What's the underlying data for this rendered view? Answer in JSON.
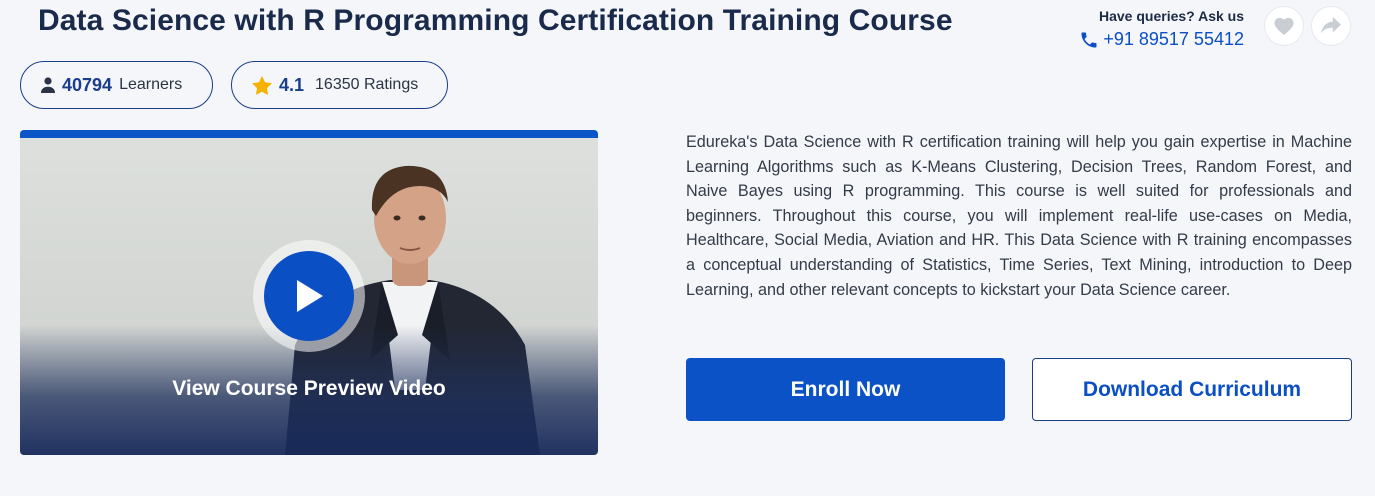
{
  "course": {
    "title": "Data Science with R Programming Certification Training Course"
  },
  "contact": {
    "label": "Have queries? Ask us",
    "phone": "+91 89517 55412"
  },
  "stats": {
    "learners_count": "40794",
    "learners_label": "Learners",
    "rating_value": "4.1",
    "ratings_label": "16350 Ratings"
  },
  "video": {
    "preview_label": "View Course Preview Video"
  },
  "description": "Edureka's Data Science with R certification training will help you gain expertise in Machine Learning Algorithms such as K-Means Clustering, Decision Trees, Random Forest, and Naive Bayes using R programming. This course is well suited for professionals and beginners. Throughout this course, you will implement real-life use-cases on Media, Healthcare, Social Media, Aviation and HR. This Data Science with R training encompasses a conceptual understanding of Statistics, Time Series, Text Mining, introduction to Deep Learning, and other relevant concepts to kickstart your Data Science career.",
  "actions": {
    "enroll_label": "Enroll Now",
    "download_label": "Download Curriculum"
  },
  "icons": {
    "phone": "phone-icon",
    "wishlist": "heart-icon",
    "share": "share-icon",
    "learners": "user-icon",
    "rating": "star-icon",
    "play": "play-icon"
  },
  "colors": {
    "brand_blue": "#0a52c6",
    "title_navy": "#1a2a4a",
    "star_yellow": "#f5b301",
    "background": "#f4f6fa"
  }
}
